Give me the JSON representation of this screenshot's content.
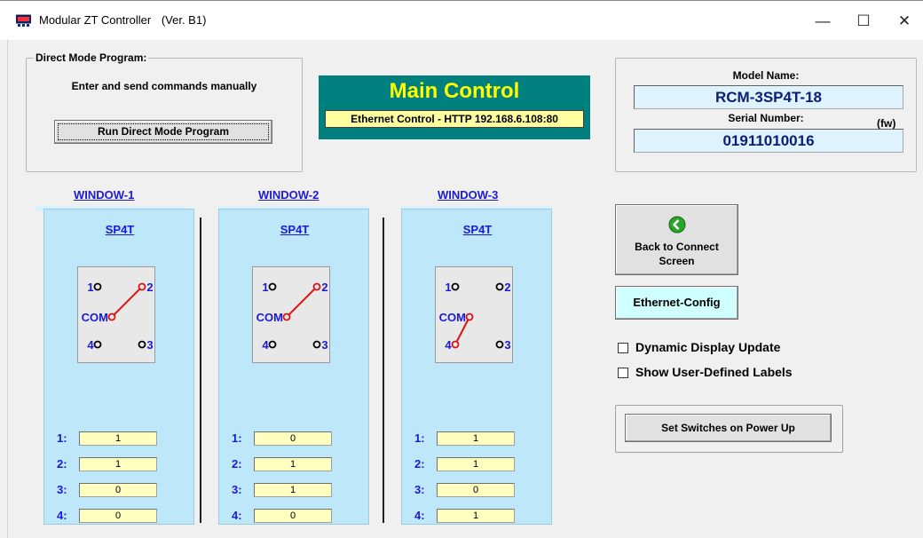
{
  "window": {
    "title": "Modular ZT Controller",
    "version": "(Ver. B1)",
    "minimize_glyph": "—",
    "maximize_glyph": "☐",
    "close_glyph": "✕"
  },
  "direct_mode": {
    "legend": "Direct Mode Program:",
    "hint": "Enter and send commands manually",
    "run_button": "Run Direct Mode Program"
  },
  "main_control": {
    "title": "Main Control",
    "status": "Ethernet Control - HTTP 192.168.6.108:80"
  },
  "device_info": {
    "model_label": "Model Name:",
    "model_value": "RCM-3SP4T-18",
    "serial_label": "Serial Number:",
    "fw_label": "(fw)",
    "serial_value": "01911010016"
  },
  "windows": [
    {
      "link": "WINDOW-1",
      "type": "SP4T",
      "connected_port": 2,
      "port_labels": [
        "1",
        "2",
        "3",
        "4"
      ],
      "com_label": "COM",
      "rows": [
        {
          "label": "1:",
          "value": "1"
        },
        {
          "label": "2:",
          "value": "1"
        },
        {
          "label": "3:",
          "value": "0"
        },
        {
          "label": "4:",
          "value": "0"
        }
      ]
    },
    {
      "link": "WINDOW-2",
      "type": "SP4T",
      "connected_port": 2,
      "port_labels": [
        "1",
        "2",
        "3",
        "4"
      ],
      "com_label": "COM",
      "rows": [
        {
          "label": "1:",
          "value": "0"
        },
        {
          "label": "2:",
          "value": "1"
        },
        {
          "label": "3:",
          "value": "1"
        },
        {
          "label": "4:",
          "value": "0"
        }
      ]
    },
    {
      "link": "WINDOW-3",
      "type": "SP4T",
      "connected_port": 4,
      "port_labels": [
        "1",
        "2",
        "3",
        "4"
      ],
      "com_label": "COM",
      "rows": [
        {
          "label": "1:",
          "value": "1"
        },
        {
          "label": "2:",
          "value": "1"
        },
        {
          "label": "3:",
          "value": "0"
        },
        {
          "label": "4:",
          "value": "1"
        }
      ]
    }
  ],
  "actions": {
    "back_button_line1": "Back to Connect",
    "back_button_line2": "Screen",
    "ethernet_config": "Ethernet-Config",
    "dynamic_display": "Dynamic Display Update",
    "user_labels": "Show User-Defined Labels",
    "power_up": "Set Switches on Power Up"
  },
  "colors": {
    "teal": "#007f7f",
    "yellow": "#ffff00",
    "link_blue": "#1a1ad6",
    "switch_red": "#e01010"
  },
  "icons": {
    "app": "switch-controller-icon",
    "back": "green-back-arrow-icon"
  }
}
